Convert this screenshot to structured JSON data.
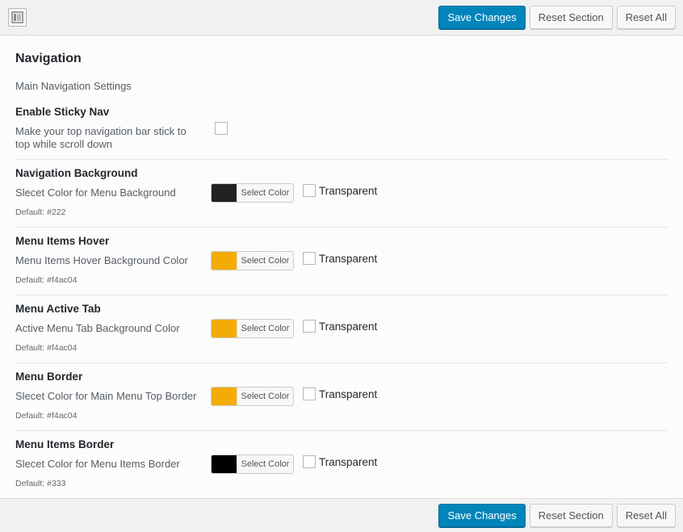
{
  "toolbar": {
    "save_label": "Save Changes",
    "reset_section_label": "Reset Section",
    "reset_all_label": "Reset All"
  },
  "section": {
    "title": "Navigation",
    "description": "Main Navigation Settings"
  },
  "sticky_nav": {
    "title": "Enable Sticky Nav",
    "description_line1": "Make your top navigation bar stick to",
    "description_line2": "top while scroll down",
    "checked": false
  },
  "color_options": [
    {
      "title": "Navigation Background",
      "description": "Slecet Color for Menu Background",
      "default": "Default: #222",
      "color": "#222222",
      "picker_label": "Select Color",
      "transparent_label": "Transparent"
    },
    {
      "title": "Menu Items Hover",
      "description": "Menu Items Hover Background Color",
      "default": "Default: #f4ac04",
      "color": "#f4ac04",
      "picker_label": "Select Color",
      "transparent_label": "Transparent"
    },
    {
      "title": "Menu Active Tab",
      "description": "Active Menu Tab Background Color",
      "default": "Default: #f4ac04",
      "color": "#f4ac04",
      "picker_label": "Select Color",
      "transparent_label": "Transparent"
    },
    {
      "title": "Menu Border",
      "description": "Slecet Color for Main Menu Top Border",
      "default": "Default: #f4ac04",
      "color": "#f4ac04",
      "picker_label": "Select Color",
      "transparent_label": "Transparent"
    },
    {
      "title": "Menu Items Border",
      "description": "Slecet Color for Menu Items Border",
      "default": "Default: #333",
      "color": "#000000",
      "picker_label": "Select Color",
      "transparent_label": "Transparent"
    }
  ],
  "icons": {
    "layout_toggle": "layout-toggle-icon"
  },
  "colors": {
    "primary_button": "#0085ba"
  }
}
